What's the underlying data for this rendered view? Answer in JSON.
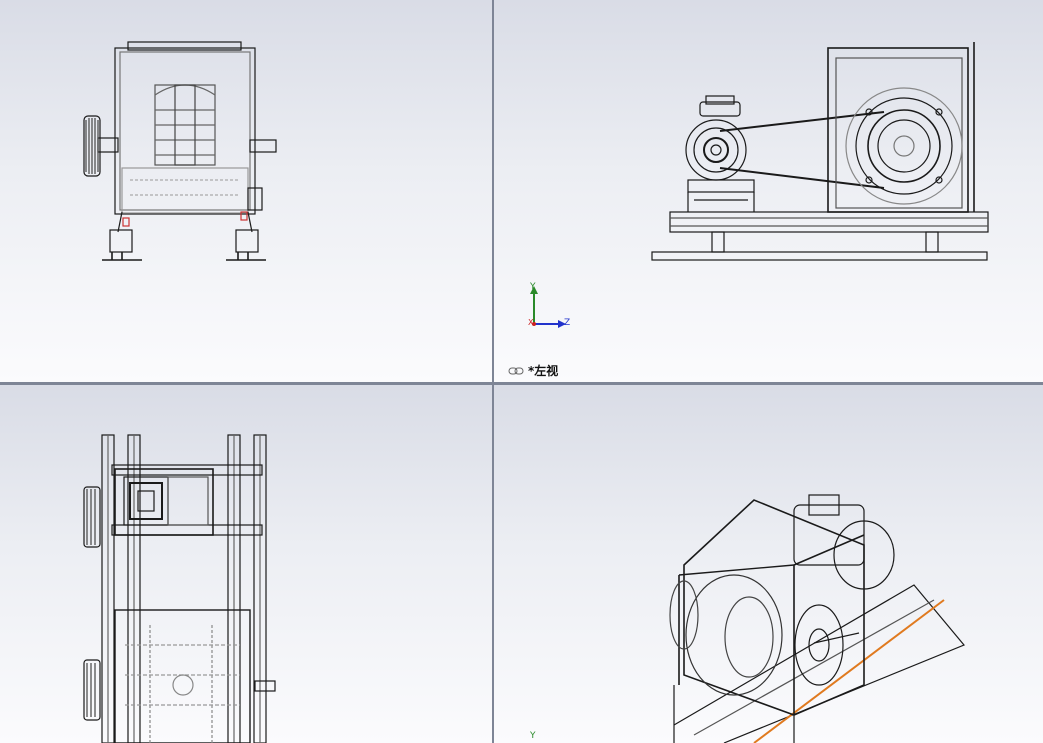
{
  "viewports": {
    "top_right": {
      "label": "*左视",
      "triad": {
        "y_axis": "Y",
        "z_axis": "Z",
        "x_axis": "X"
      }
    },
    "bottom_right": {
      "triad": {
        "y_axis": "Y"
      }
    }
  },
  "icons": {
    "view_link": "link-icon",
    "triad": "axis-triad-icon"
  },
  "colors": {
    "background_top": "#d9dce6",
    "background_bottom": "#fbfbfd",
    "divider": "#7e8596",
    "line": "#1a1a1a",
    "highlight_edge": "#e07a1f",
    "axis_y": "#2a8a2a",
    "axis_z": "#2233cc",
    "axis_x": "#cc2222"
  }
}
